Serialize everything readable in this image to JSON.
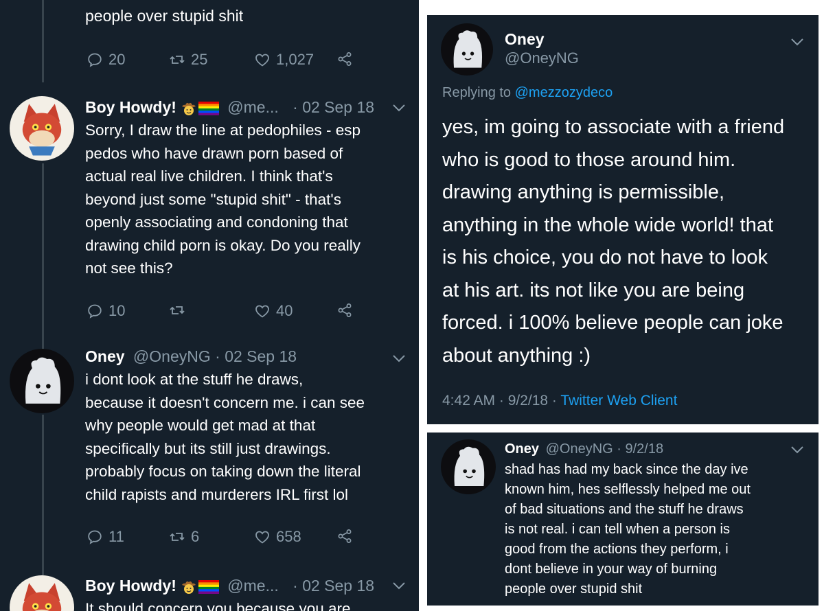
{
  "left": {
    "top_tweet": {
      "tail_text": "people over stupid shit",
      "replies": "20",
      "retweets": "25",
      "likes": "1,027"
    },
    "tweet1": {
      "name": "Boy Howdy!",
      "handle": "@me...",
      "date": "· 02 Sep 18",
      "lines": [
        "Sorry, I draw the line at pedophiles - esp",
        "pedos who have drawn porn based of",
        "actual real live children. I think that's",
        "beyond just some \"stupid shit\" - that's",
        "openly associating and condoning that",
        "drawing child porn is okay. Do you really",
        "not see this?"
      ],
      "replies": "10",
      "likes": "40"
    },
    "tweet2": {
      "name": "Oney",
      "handle": "@OneyNG",
      "date": "· 02 Sep 18",
      "lines": [
        "i dont look at the stuff he draws,",
        "because it doesn't concern me. i can see",
        "why people would get mad at that",
        "specifically but its still just drawings.",
        "probably focus on taking down the literal",
        "child rapists and murderers IRL first lol"
      ],
      "replies": "11",
      "retweets": "6",
      "likes": "658"
    },
    "tweet3": {
      "name": "Boy Howdy!",
      "handle": "@me...",
      "date": "· 02 Sep 18",
      "partial_line": "It should concern you because you are"
    }
  },
  "right_top": {
    "name": "Oney",
    "handle": "@OneyNG",
    "replying_label": "Replying to",
    "replying_handle": "@mezzozydeco",
    "lines": [
      "yes, im going to associate with a friend",
      "who is good to those around him.",
      "drawing anything is permissible,",
      "anything in the whole wide world! that",
      "is his choice, you do not have to look",
      "at his art. its not like you are being",
      "forced. i 100% believe people can joke",
      "about anything :)"
    ],
    "time": "4:42 AM · 9/2/18 ·",
    "client": "Twitter Web Client"
  },
  "right_bottom": {
    "name": "Oney",
    "handle": "@OneyNG · 9/2/18",
    "lines": [
      "shad has had my back since the day ive",
      "known him, hes selflessly helped me out",
      "of bad situations and the stuff he draws",
      "is not real. i can tell when a person is",
      "good from the actions they perform, i",
      "dont believe in your way of burning",
      "people over stupid shit"
    ]
  },
  "colors": {
    "background": "#15202b",
    "muted": "#8899a6",
    "link": "#1da1f2",
    "thread": "#38444d"
  },
  "icons": [
    "reply-icon",
    "retweet-icon",
    "like-icon",
    "share-icon",
    "chevron-down-icon",
    "cowboy-emoji-icon",
    "rainbow-flag-icon"
  ]
}
